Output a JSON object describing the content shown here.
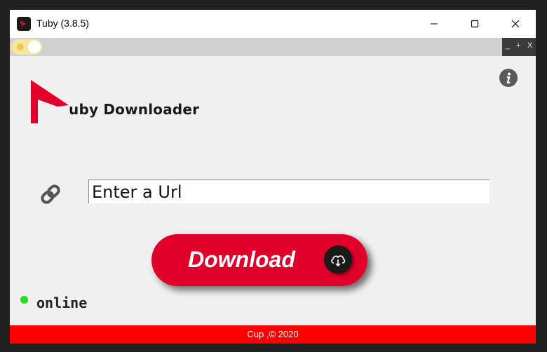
{
  "window": {
    "title": "Tuby (3.8.5)",
    "controls": [
      "minimize-icon",
      "maximize-icon",
      "close-icon"
    ]
  },
  "menubar": {
    "theme_toggle": "theme-toggle",
    "mini_controls": {
      "minimize": "_",
      "maximize": "+",
      "close": "X"
    }
  },
  "brand": {
    "name": "uby Downloader"
  },
  "url": {
    "placeholder": "Enter a Url",
    "value": ""
  },
  "download": {
    "label": "Download",
    "icon": "cloud-download-icon"
  },
  "status": {
    "text": "online",
    "color": "#22dd22"
  },
  "footer": {
    "text": "Cup ,© 2020"
  },
  "colors": {
    "accent": "#e0002a",
    "footer": "#ff0000"
  }
}
